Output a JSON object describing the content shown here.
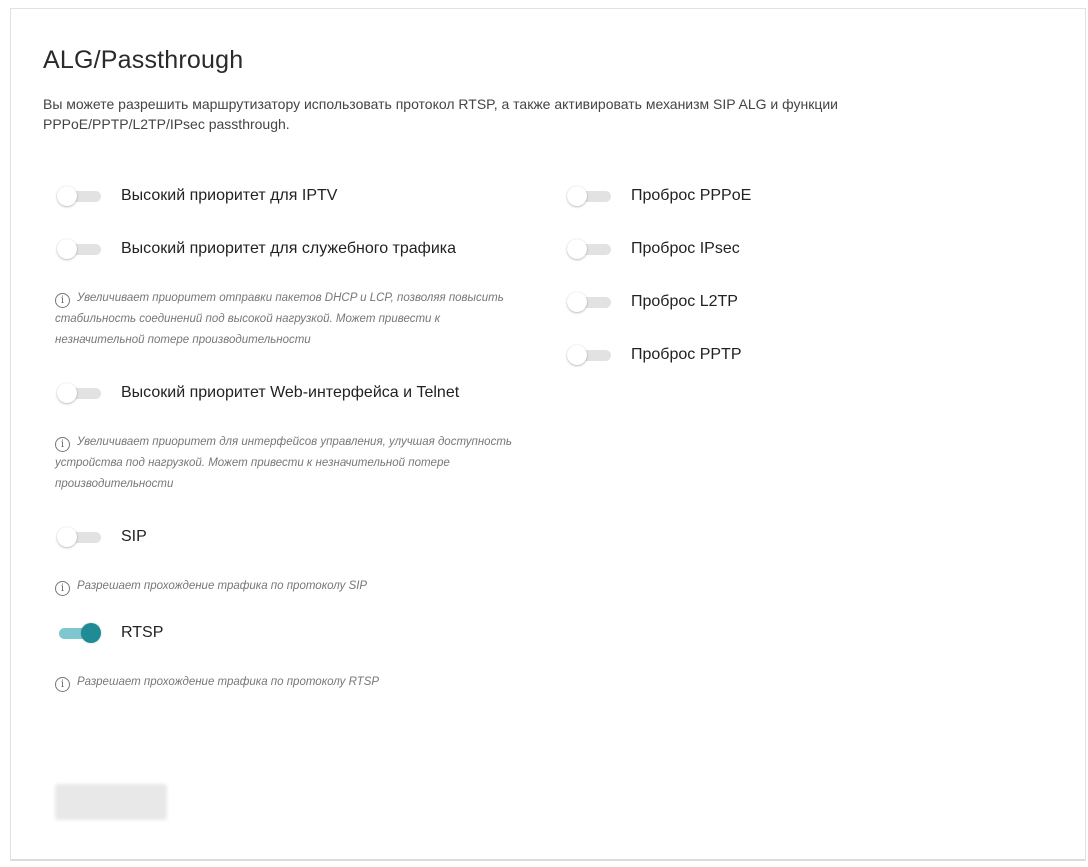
{
  "page": {
    "title": "ALG/Passthrough",
    "description": "Вы можете разрешить маршрутизатору использовать протокол RTSP, а также активировать механизм SIP ALG и функции PPPoE/PPTP/L2TP/IPsec passthrough."
  },
  "left": {
    "iptv": {
      "label": "Высокий приоритет для IPTV",
      "enabled": false
    },
    "service": {
      "label": "Высокий приоритет для служебного трафика",
      "enabled": false,
      "hint": "Увеличивает приоритет отправки пакетов DHCP и LCP, позволяя повысить стабильность соединений под высокой нагрузкой. Может привести к незначительной потере производительности"
    },
    "web": {
      "label": "Высокий приоритет Web-интерфейса и Telnet",
      "enabled": false,
      "hint": "Увеличивает приоритет для интерфейсов управления, улучшая доступность устройства под нагрузкой. Может привести к незначительной потере производительности"
    },
    "sip": {
      "label": "SIP",
      "enabled": false,
      "hint": "Разрешает прохождение трафика по протоколу SIP"
    },
    "rtsp": {
      "label": "RTSP",
      "enabled": true,
      "hint": "Разрешает прохождение трафика по протоколу RTSP"
    }
  },
  "right": {
    "pppoe": {
      "label": "Проброс PPPoE",
      "enabled": false
    },
    "ipsec": {
      "label": "Проброс IPsec",
      "enabled": false
    },
    "l2tp": {
      "label": "Проброс L2TP",
      "enabled": false
    },
    "pptp": {
      "label": "Проброс PPTP",
      "enabled": false
    }
  },
  "colors": {
    "accent": "#1f8b95",
    "accent_track": "#7fc7cf",
    "off_track": "#e2e2e2"
  },
  "icons": {
    "info": "info-circle-icon"
  }
}
